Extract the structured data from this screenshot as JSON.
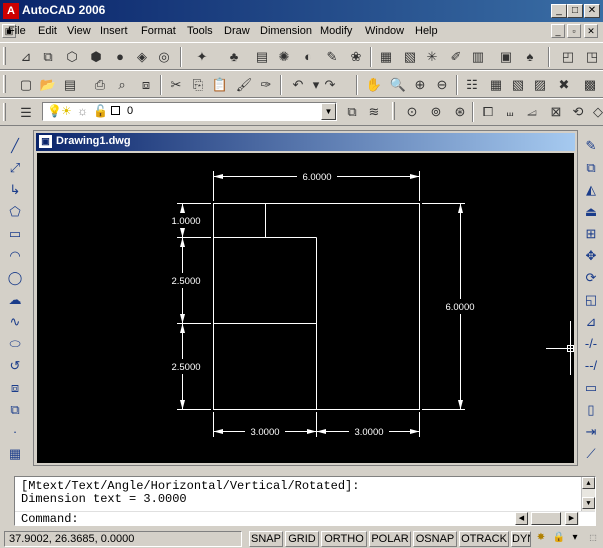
{
  "window": {
    "title": "AutoCAD 2006"
  },
  "menu": {
    "items": [
      "File",
      "Edit",
      "View",
      "Insert",
      "Format",
      "Tools",
      "Draw",
      "Dimension",
      "Modify",
      "Window",
      "Help"
    ]
  },
  "layer": {
    "current": "0"
  },
  "document": {
    "title": "Drawing1.dwg"
  },
  "drawing": {
    "color": "#ffffff",
    "dimensions": [
      {
        "label": "6.0000",
        "orientation": "horizontal"
      },
      {
        "label": "1.0000",
        "orientation": "vertical"
      },
      {
        "label": "2.5000",
        "orientation": "vertical"
      },
      {
        "label": "2.5000",
        "orientation": "vertical"
      },
      {
        "label": "6.0000",
        "orientation": "vertical"
      },
      {
        "label": "3.0000",
        "orientation": "horizontal"
      },
      {
        "label": "3.0000",
        "orientation": "horizontal"
      }
    ]
  },
  "command": {
    "history": [
      "[Mtext/Text/Angle/Horizontal/Vertical/Rotated]:",
      "Dimension text = 3.0000"
    ],
    "prompt": "Command:"
  },
  "status": {
    "coordinates": "37.9002, 26.3685, 0.0000",
    "toggles": [
      "SNAP",
      "GRID",
      "ORTHO",
      "POLAR",
      "OSNAP",
      "OTRACK",
      "DYN"
    ]
  },
  "colors": {
    "title_bar": "#0a246a",
    "canvas": "#000000",
    "chrome": "#d4d0c8"
  }
}
